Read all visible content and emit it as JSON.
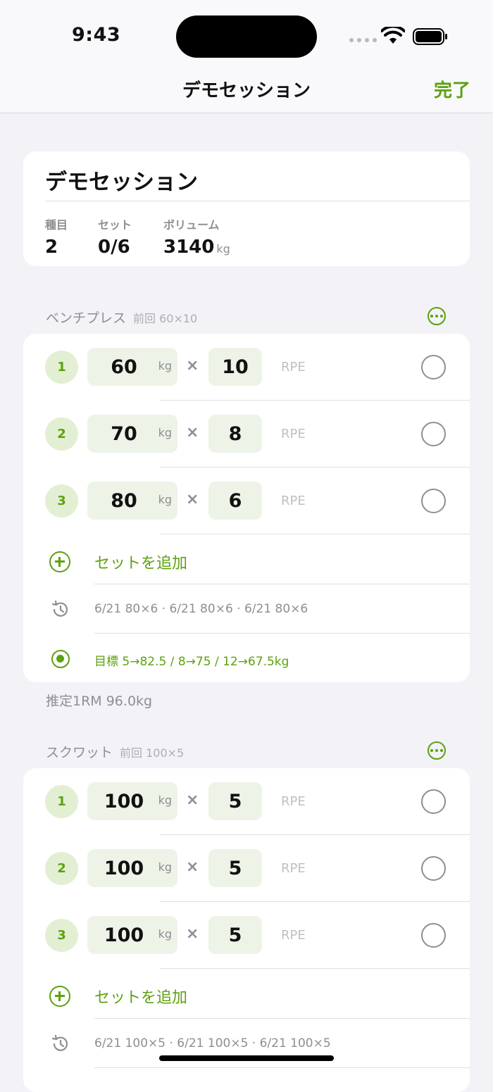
{
  "status": {
    "time": "9:43"
  },
  "nav": {
    "title": "デモセッション",
    "done": "完了"
  },
  "summary": {
    "title": "デモセッション",
    "stats": [
      {
        "label": "種目",
        "value": "2",
        "unit": ""
      },
      {
        "label": "セット",
        "value": "0/6",
        "unit": ""
      },
      {
        "label": "ボリューム",
        "value": "3140",
        "unit": "kg"
      }
    ]
  },
  "exercises": [
    {
      "name": "ベンチプレス",
      "previous": "前回 60×10",
      "sets": [
        {
          "num": "1",
          "weight": "60",
          "unit": "kg",
          "reps": "10",
          "rpe": "RPE"
        },
        {
          "num": "2",
          "weight": "70",
          "unit": "kg",
          "reps": "8",
          "rpe": "RPE"
        },
        {
          "num": "3",
          "weight": "80",
          "unit": "kg",
          "reps": "6",
          "rpe": "RPE"
        }
      ],
      "add_set": "セットを追加",
      "history": "6/21 80×6 · 6/21 80×6 · 6/21 80×6",
      "goal": "目標 5→82.5 / 8→75 / 12→67.5kg",
      "estimate": "推定1RM 96.0kg"
    },
    {
      "name": "スクワット",
      "previous": "前回 100×5",
      "sets": [
        {
          "num": "1",
          "weight": "100",
          "unit": "kg",
          "reps": "5",
          "rpe": "RPE"
        },
        {
          "num": "2",
          "weight": "100",
          "unit": "kg",
          "reps": "5",
          "rpe": "RPE"
        },
        {
          "num": "3",
          "weight": "100",
          "unit": "kg",
          "reps": "5",
          "rpe": "RPE"
        }
      ],
      "add_set": "セットを追加",
      "history": "6/21 100×5 · 6/21 100×5 · 6/21 100×5"
    }
  ],
  "colors": {
    "accent": "#5da10f",
    "background": "#f2f2f7",
    "chip": "#eef3e7"
  }
}
